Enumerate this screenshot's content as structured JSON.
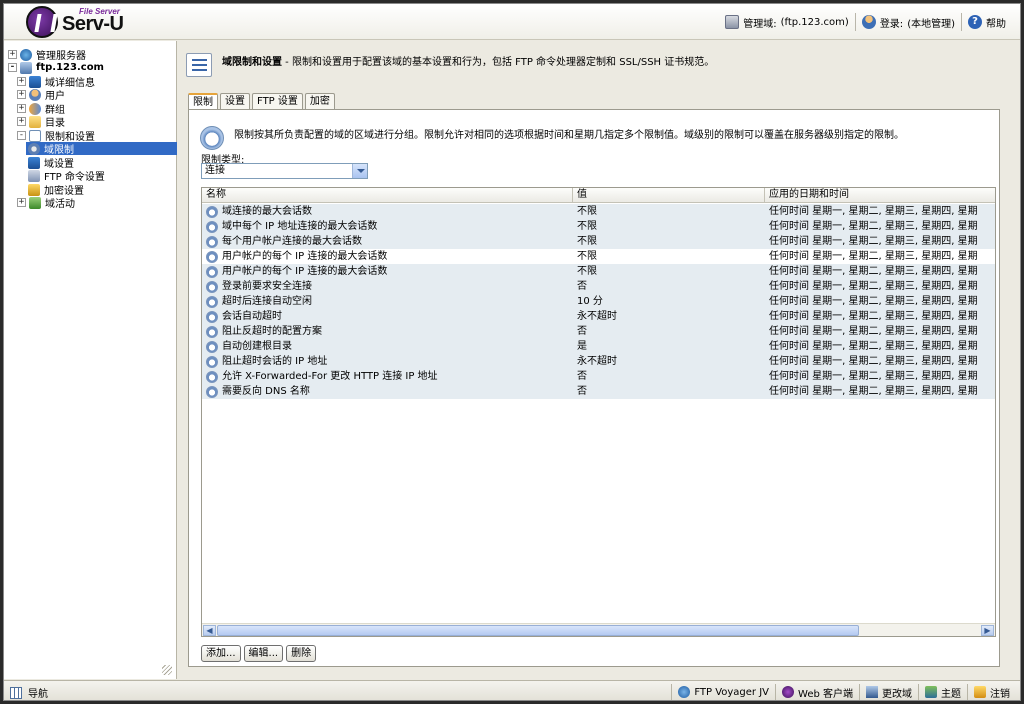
{
  "header": {
    "logo_tagline": "File Server",
    "logo_name": "Serv-U",
    "admin_domain_label": "管理域:",
    "admin_domain_value": "(ftp.123.com)",
    "login_label": "登录:",
    "login_value": "(本地管理)",
    "help_label": "帮助"
  },
  "tree": {
    "items": [
      {
        "label": "管理服务器",
        "expander": "+"
      },
      {
        "label": "ftp.123.com",
        "expander": "-"
      },
      {
        "label": "域详细信息",
        "expander": "+"
      },
      {
        "label": "用户",
        "expander": "+"
      },
      {
        "label": "群组",
        "expander": "+"
      },
      {
        "label": "目录",
        "expander": "+"
      },
      {
        "label": "限制和设置",
        "expander": "-"
      },
      {
        "label": "域限制",
        "expander": ""
      },
      {
        "label": "域设置",
        "expander": ""
      },
      {
        "label": "FTP 命令设置",
        "expander": ""
      },
      {
        "label": "加密设置",
        "expander": ""
      },
      {
        "label": "域活动",
        "expander": "+"
      }
    ]
  },
  "main": {
    "title_bold": "域限制和设置",
    "title_rest": " - 限制和设置用于配置该域的基本设置和行为，包括 FTP 命令处理器定制和 SSL/SSH 证书规范。",
    "tabs": [
      "限制",
      "设置",
      "FTP 设置",
      "加密"
    ],
    "active_tab": "限制",
    "description": "限制按其所负责配置的域的区域进行分组。限制允许对相同的选项根据时间和星期几指定多个限制值。域级别的限制可以覆盖在服务器级别指定的限制。",
    "limit_type_label": "限制类型:",
    "limit_type_value": "连接",
    "columns": [
      "名称",
      "值",
      "应用的日期和时间"
    ],
    "rows": [
      {
        "name": "域连接的最大会话数",
        "value": "不限",
        "date": "任何时间  星期一,  星期二,  星期三,  星期四,  星期"
      },
      {
        "name": "域中每个 IP 地址连接的最大会话数",
        "value": "不限",
        "date": "任何时间  星期一,  星期二,  星期三,  星期四,  星期"
      },
      {
        "name": "每个用户帐户连接的最大会话数",
        "value": "不限",
        "date": "任何时间  星期一,  星期二,  星期三,  星期四,  星期"
      },
      {
        "name": "用户帐户的每个 IP 连接的最大会话数",
        "value": "不限",
        "date": "任何时间  星期一,  星期二,  星期三,  星期四,  星期"
      },
      {
        "name": "用户帐户的每个 IP 连接的最大会话数",
        "value": "不限",
        "date": "任何时间  星期一,  星期二,  星期三,  星期四,  星期"
      },
      {
        "name": "登录前要求安全连接",
        "value": "否",
        "date": "任何时间  星期一,  星期二,  星期三,  星期四,  星期"
      },
      {
        "name": "超时后连接自动空闲",
        "value": "10 分",
        "date": "任何时间  星期一,  星期二,  星期三,  星期四,  星期"
      },
      {
        "name": "会话自动超时",
        "value": "永不超时",
        "date": "任何时间  星期一,  星期二,  星期三,  星期四,  星期"
      },
      {
        "name": "阻止反超时的配置方案",
        "value": "否",
        "date": "任何时间  星期一,  星期二,  星期三,  星期四,  星期"
      },
      {
        "name": "自动创建根目录",
        "value": "是",
        "date": "任何时间  星期一,  星期二,  星期三,  星期四,  星期"
      },
      {
        "name": "阻止超时会话的 IP 地址",
        "value": "永不超时",
        "date": "任何时间  星期一,  星期二,  星期三,  星期四,  星期"
      },
      {
        "name": "允许 X-Forwarded-For 更改 HTTP 连接 IP 地址",
        "value": "否",
        "date": "任何时间  星期一,  星期二,  星期三,  星期四,  星期"
      },
      {
        "name": "需要反向 DNS 名称",
        "value": "否",
        "date": "任何时间  星期一,  星期二,  星期三,  星期四,  星期"
      }
    ],
    "selected_row": 3,
    "buttons": {
      "add": "添加...",
      "edit": "编辑...",
      "delete": "删除"
    }
  },
  "statusbar": {
    "nav_label": "导航",
    "ftp_voyager": "FTP Voyager JV",
    "web_client": "Web 客户端",
    "change_domain": "更改域",
    "theme": "主题",
    "logout": "注销"
  }
}
